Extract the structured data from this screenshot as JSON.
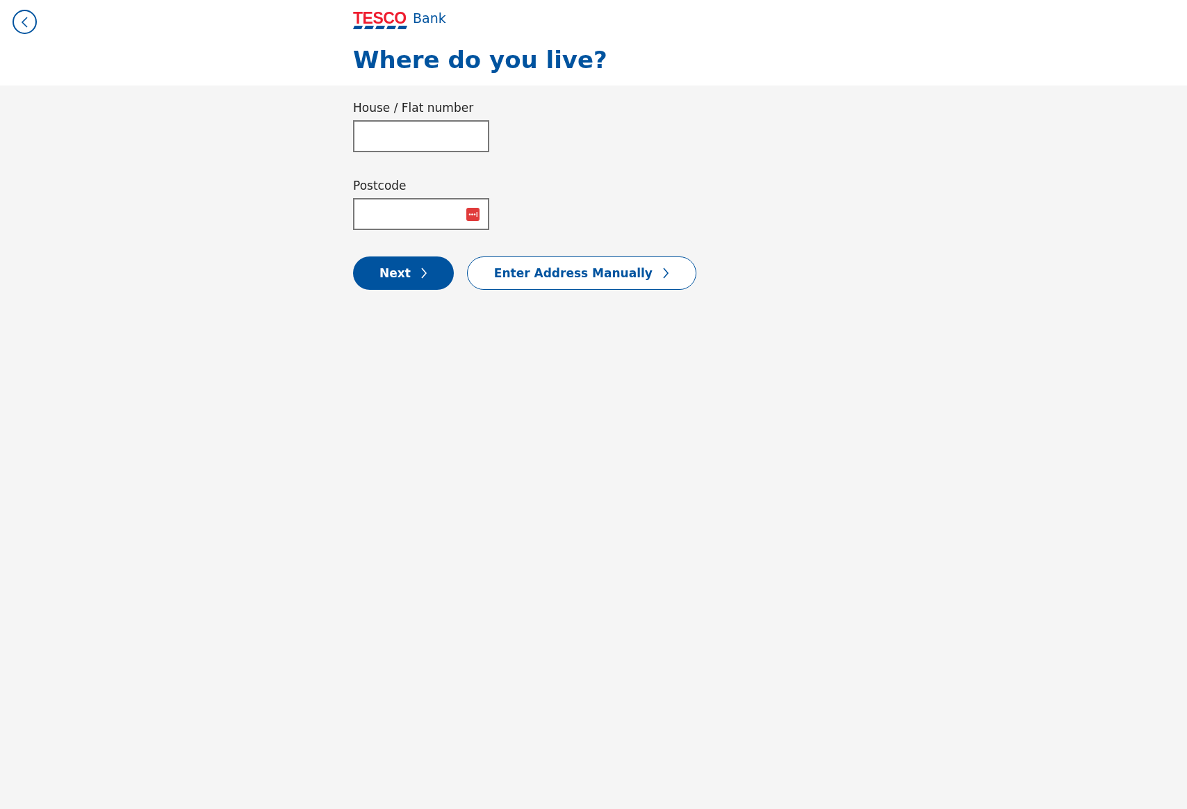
{
  "header": {
    "logo": {
      "brand": "TESCO",
      "suffix": "Bank"
    },
    "title": "Where do you live?"
  },
  "form": {
    "fields": [
      {
        "label": "House / Flat number",
        "kind": "text"
      },
      {
        "label": "Postcode",
        "kind": "autofill"
      }
    ],
    "buttons": [
      {
        "label": "Next",
        "kind": "primary"
      },
      {
        "label": "Enter Address Manually",
        "kind": "secondary"
      }
    ]
  }
}
